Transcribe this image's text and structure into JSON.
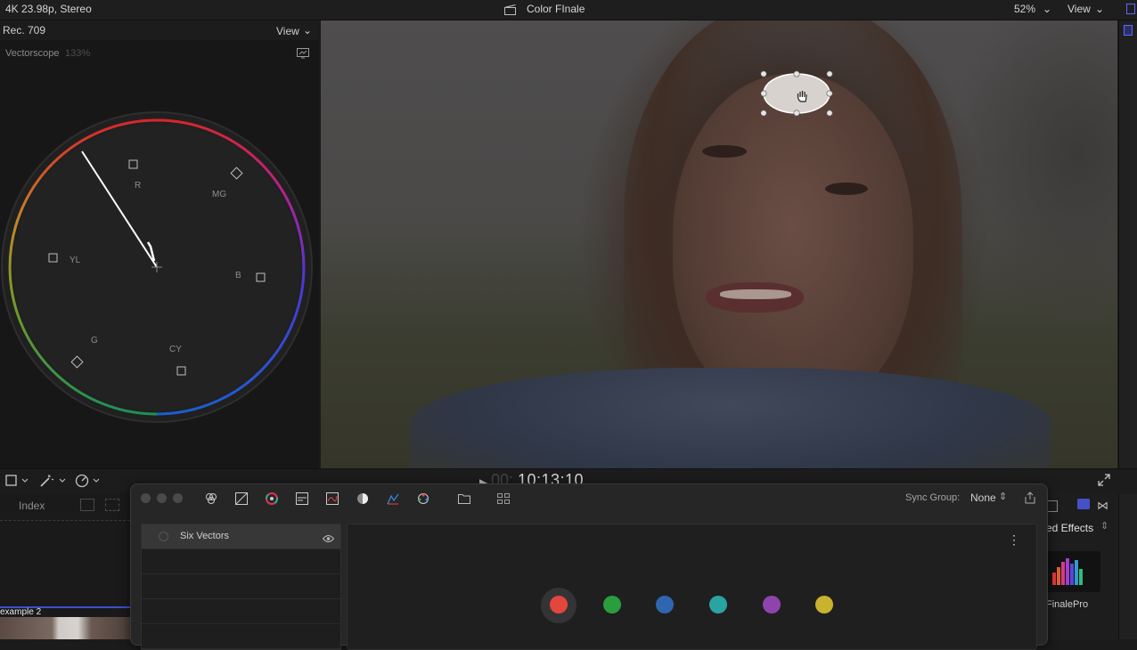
{
  "topbar": {
    "format": "4K 23.98p, Stereo",
    "project_title": "Color FInale",
    "zoom": "52%",
    "view_label": "View"
  },
  "scope": {
    "standard": "Rec. 709",
    "view_label": "View",
    "scope_name": "Vectorscope",
    "scope_zoom": "133%",
    "targets": {
      "r": "R",
      "mg": "MG",
      "b": "B",
      "cy": "CY",
      "g": "G",
      "yl": "YL"
    }
  },
  "viewer": {
    "timecode_dim": "00:",
    "timecode": "10:13:10"
  },
  "timeline": {
    "index_label": "Index",
    "clip_label": "example 2"
  },
  "effects": {
    "browser_label": "ed Effects",
    "item_label": "FinalePro"
  },
  "plugin": {
    "sync_group_label": "Sync Group:",
    "sync_group_value": "None",
    "layer_name": "Six Vectors",
    "vector_colors": [
      "#e2463d",
      "#2a9d3d",
      "#2f66b0",
      "#2aa3a1",
      "#8e44ad",
      "#c9b22e"
    ]
  }
}
